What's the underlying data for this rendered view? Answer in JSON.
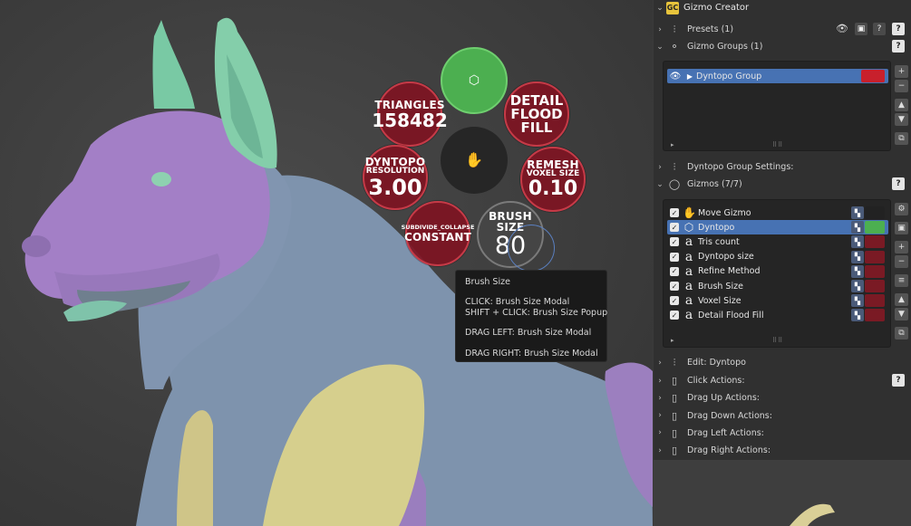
{
  "panel": {
    "title": "Gizmo Creator",
    "logo": "GC",
    "presets_label": "Presets (1)",
    "groups_label": "Gizmo Groups (1)",
    "group_item": "Dyntopo Group",
    "group_settings_label": "Dyntopo Group Settings:",
    "gizmos_label": "Gizmos (7/7)",
    "gizmos": [
      {
        "label": "Move Gizmo",
        "icon": "hand-icon",
        "swatch": "#222222"
      },
      {
        "label": "Dyntopo",
        "icon": "dyntopo-icon",
        "swatch": "#4caf50"
      },
      {
        "label": "Tris count",
        "icon": "text-icon",
        "swatch": "#7a1a24"
      },
      {
        "label": "Dyntopo size",
        "icon": "text-icon",
        "swatch": "#7a1a24"
      },
      {
        "label": "Refine Method",
        "icon": "text-icon",
        "swatch": "#7a1a24"
      },
      {
        "label": "Brush Size",
        "icon": "text-icon",
        "swatch": "#7a1a24"
      },
      {
        "label": "Voxel Size",
        "icon": "text-icon",
        "swatch": "#7a1a24"
      },
      {
        "label": "Detail Flood Fill",
        "icon": "text-icon",
        "swatch": "#7a1a24"
      }
    ],
    "edit_label": "Edit: Dyntopo",
    "actions": [
      "Click Actions:",
      "Drag Up Actions:",
      "Drag Down Actions:",
      "Drag Left Actions:",
      "Drag Right Actions:"
    ]
  },
  "pie": {
    "triangles": {
      "label": "TRIANGLES",
      "value": "158482"
    },
    "detail": {
      "l1": "DETAIL",
      "l2": "FLOOD",
      "l3": "FILL"
    },
    "dyntopo": {
      "label": "DYNTOPO",
      "sub": "RESOLUTION",
      "value": "3.00"
    },
    "remesh": {
      "label": "REMESH",
      "sub": "VOXEL SIZE",
      "value": "0.10"
    },
    "subdivide": {
      "label": "SUBDIVIDE_COLLAPSE",
      "value": "CONSTANT"
    },
    "brush": {
      "label": "BRUSH SIZE",
      "value": "80"
    }
  },
  "tooltip": {
    "title": "Brush Size",
    "click": "CLICK: Brush Size Modal",
    "shift_click": "SHIFT + CLICK: Brush Size Popup",
    "drag_left": "DRAG LEFT: Brush Size Modal",
    "drag_right": "DRAG RIGHT: Brush Size Modal"
  },
  "colors": {
    "accent": "#4772b3",
    "pie_red": "#7e1422",
    "pie_green": "#4caf50",
    "group_swatch": "#c8202c"
  }
}
